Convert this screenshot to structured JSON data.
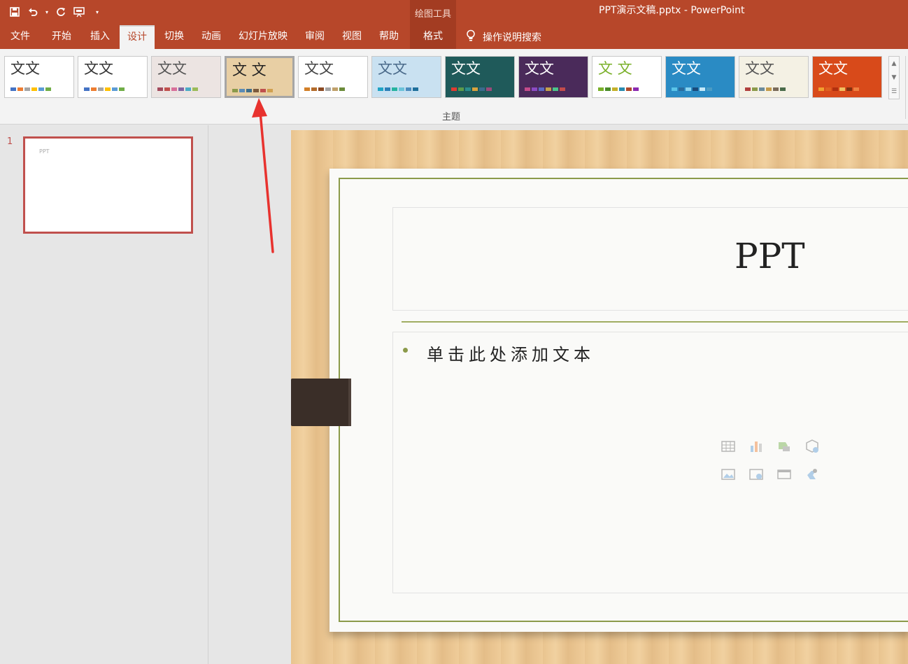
{
  "titlebar": {
    "context_tool": "绘图工具",
    "document_title": "PPT演示文稿.pptx  -  PowerPoint",
    "qat_icons": [
      "save-icon",
      "undo-icon",
      "redo-icon",
      "present-icon",
      "customize-icon"
    ],
    "colors": {
      "accent": "#b7472a",
      "context": "#a33c22"
    }
  },
  "tabs": {
    "file": "文件",
    "home": "开始",
    "insert": "插入",
    "design": "设计",
    "transitions": "切换",
    "animations": "动画",
    "slideshow": "幻灯片放映",
    "review": "审阅",
    "view": "视图",
    "help": "帮助",
    "format": "格式",
    "tell_me": "操作说明搜索"
  },
  "ribbon": {
    "group_label": "主题",
    "themes": [
      {
        "text": "文文",
        "text_color": "#333333",
        "bg": "#ffffff",
        "swatches": [
          "#4472c4",
          "#ed7d31",
          "#a5a5a5",
          "#ffc000",
          "#5b9bd5",
          "#70ad47"
        ]
      },
      {
        "text": "文文",
        "text_color": "#333333",
        "bg": "#ffffff",
        "swatches": [
          "#4472c4",
          "#ed7d31",
          "#a5a5a5",
          "#ffc000",
          "#5b9bd5",
          "#70ad47"
        ]
      },
      {
        "text": "文文",
        "text_color": "#555555",
        "bg": "#ece4e2",
        "swatches": [
          "#a34b5d",
          "#c0504d",
          "#d86f9a",
          "#8064a2",
          "#4bacc6",
          "#9bbb59"
        ]
      },
      {
        "text": "文 文",
        "text_color": "#222222",
        "bg": "#e8cfa4",
        "swatches": [
          "#8b9a4a",
          "#5b8bb5",
          "#3f6f8b",
          "#7d5a3c",
          "#c0504d",
          "#d0a050"
        ]
      },
      {
        "text": "文文",
        "text_color": "#444444",
        "bg": "#ffffff",
        "swatches": [
          "#d27f28",
          "#b36b2a",
          "#8b4a23",
          "#a5a5a5",
          "#c0a16b",
          "#6b8b3a"
        ]
      },
      {
        "text": "文文",
        "text_color": "#4a6a8a",
        "bg": "#c9e1f1",
        "swatches": [
          "#1fa3c4",
          "#2c7fb8",
          "#26b3a0",
          "#6bc2d9",
          "#4b8bbe",
          "#1f6f9b"
        ]
      },
      {
        "text": "文文",
        "text_color": "#ffffff",
        "bg": "#1f5a5a",
        "swatches": [
          "#e03c31",
          "#5c9b4a",
          "#2a8d8d",
          "#d8a23d",
          "#3a6b8d",
          "#9b4a7a"
        ]
      },
      {
        "text": "文文",
        "text_color": "#ffffff",
        "bg": "#4a2a5a",
        "swatches": [
          "#c44b8b",
          "#8b4ac4",
          "#5a6bc4",
          "#c4a24b",
          "#4bc48b",
          "#c44b4b"
        ]
      },
      {
        "text": "文 文",
        "text_color": "#7ab02a",
        "bg": "#ffffff",
        "swatches": [
          "#7ab02a",
          "#4a8b2a",
          "#c4b02a",
          "#2a8bb0",
          "#b04a2a",
          "#8b2ab0"
        ]
      },
      {
        "text": "文文",
        "text_color": "#ffffff",
        "bg": "#2a8bc4",
        "swatches": [
          "#5ac4e8",
          "#2a6b9b",
          "#8bd4f0",
          "#1a4a7a",
          "#c4e8f8",
          "#4a9bc4"
        ]
      },
      {
        "text": "文文",
        "text_color": "#555555",
        "bg": "#f4f1e4",
        "swatches": [
          "#b0413e",
          "#8b9a4a",
          "#6b8b9b",
          "#c49b4a",
          "#7a6b5a",
          "#4a6b4a"
        ]
      },
      {
        "text": "文文",
        "text_color": "#ffffff",
        "bg": "#d84a1a",
        "swatches": [
          "#f0a030",
          "#e06020",
          "#b03010",
          "#f0c060",
          "#803010",
          "#f08040"
        ]
      }
    ]
  },
  "thumbnails": {
    "slide_number": "1",
    "slide_title": "PPT"
  },
  "slide": {
    "title": "PPT",
    "body_placeholder": "单击此处添加文本",
    "content_icons": [
      "table-icon",
      "chart-icon",
      "smartart-icon",
      "3d-model-icon",
      "picture-icon",
      "online-picture-icon",
      "video-icon",
      "icons-icon"
    ]
  }
}
